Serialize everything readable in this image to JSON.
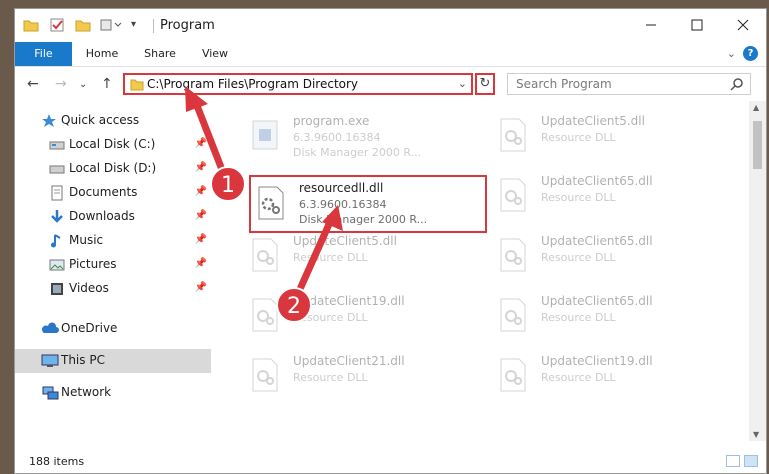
{
  "window": {
    "title": "Program"
  },
  "ribbon": {
    "tabs": [
      "File",
      "Home",
      "Share",
      "View"
    ]
  },
  "address": {
    "path": "C:\\Program Files\\Program Directory"
  },
  "search": {
    "placeholder": "Search Program"
  },
  "sidebar": {
    "items": [
      {
        "label": "Quick access",
        "icon": "star-icon",
        "pinned": false
      },
      {
        "label": "Local Disk (C:)",
        "icon": "drive-icon",
        "pinned": true
      },
      {
        "label": "Local Disk (D:)",
        "icon": "drive-icon",
        "pinned": true
      },
      {
        "label": "Documents",
        "icon": "documents-icon",
        "pinned": true
      },
      {
        "label": "Downloads",
        "icon": "download-icon",
        "pinned": true
      },
      {
        "label": "Music",
        "icon": "music-icon",
        "pinned": true
      },
      {
        "label": "Pictures",
        "icon": "pictures-icon",
        "pinned": true
      },
      {
        "label": "Videos",
        "icon": "videos-icon",
        "pinned": true
      },
      {
        "label": "OneDrive",
        "icon": "cloud-icon",
        "pinned": false
      },
      {
        "label": "This PC",
        "icon": "computer-icon",
        "pinned": false
      },
      {
        "label": "Network",
        "icon": "network-icon",
        "pinned": false
      }
    ]
  },
  "files": [
    {
      "name": "program.exe",
      "line1": "6.3.9600.16384",
      "line2": "Disk Manager 2000 R...",
      "icon": "exe-icon"
    },
    {
      "name": "UpdateClient5.dll",
      "line1": "Resource DLL",
      "line2": "",
      "icon": "dll-icon"
    },
    {
      "name": "resourcedll.dll",
      "line1": "6.3.9600.16384",
      "line2": "Disk Manager 2000 R...",
      "icon": "dll-gear-icon"
    },
    {
      "name": "UpdateClient65.dll",
      "line1": "Resource DLL",
      "line2": "",
      "icon": "dll-icon"
    },
    {
      "name": "UpdateClient5.dll",
      "line1": "Resource DLL",
      "line2": "",
      "icon": "dll-icon"
    },
    {
      "name": "UpdateClient65.dll",
      "line1": "Resource DLL",
      "line2": "",
      "icon": "dll-icon"
    },
    {
      "name": "UpdateClient19.dll",
      "line1": "Resource DLL",
      "line2": "",
      "icon": "dll-icon"
    },
    {
      "name": "UpdateClient65.dll",
      "line1": "Resource DLL",
      "line2": "",
      "icon": "dll-icon"
    },
    {
      "name": "UpdateClient21.dll",
      "line1": "Resource DLL",
      "line2": "",
      "icon": "dll-icon"
    },
    {
      "name": "UpdateClient19.dll",
      "line1": "Resource DLL",
      "line2": "",
      "icon": "dll-icon"
    }
  ],
  "status": {
    "count": "188 items"
  },
  "annotations": {
    "step1": "1",
    "step2": "2",
    "color": "#d9363e"
  }
}
